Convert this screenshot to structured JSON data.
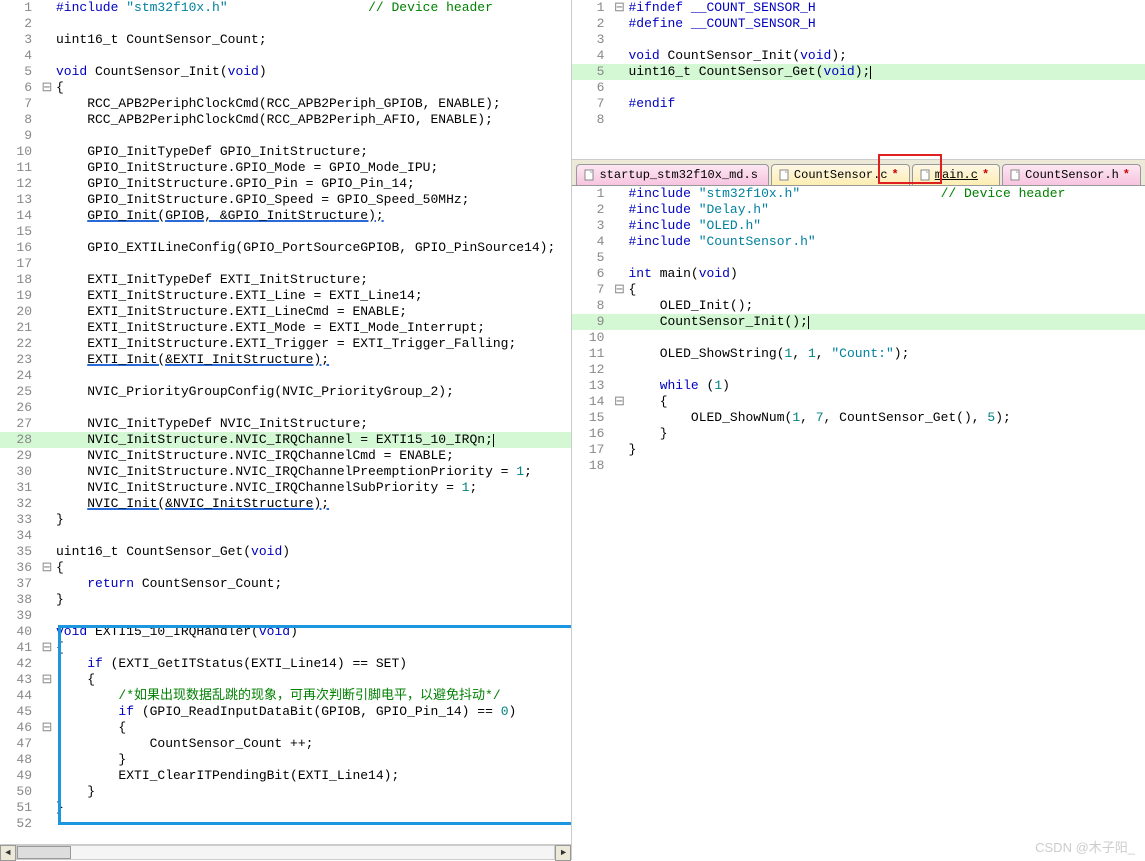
{
  "tabs": {
    "right_bottom": [
      {
        "label": "startup_stm32f10x_md.s",
        "style": "pink",
        "modified": false
      },
      {
        "label": "CountSensor.c",
        "style": "yellow",
        "modified": true,
        "underline": false
      },
      {
        "label": "main.c",
        "style": "yellow",
        "modified": true,
        "underline": true,
        "active_box": true
      },
      {
        "label": "CountSensor.h",
        "style": "pink",
        "modified": true
      }
    ]
  },
  "left_editor": {
    "lines": [
      {
        "n": 1,
        "fold": "",
        "tokens": [
          [
            "#include ",
            "kw"
          ],
          [
            "\"stm32f10x.h\"",
            "str"
          ],
          [
            "                  ",
            ""
          ],
          [
            "// Device header",
            "cmt"
          ]
        ]
      },
      {
        "n": 2,
        "fold": "",
        "tokens": [
          [
            "",
            ""
          ]
        ]
      },
      {
        "n": 3,
        "fold": "",
        "tokens": [
          [
            "uint16_t CountSensor_Count;",
            ""
          ]
        ]
      },
      {
        "n": 4,
        "fold": "",
        "tokens": [
          [
            "",
            ""
          ]
        ]
      },
      {
        "n": 5,
        "fold": "",
        "tokens": [
          [
            "void ",
            "kw"
          ],
          [
            "CountSensor_Init(",
            ""
          ],
          [
            "void",
            "kw"
          ],
          [
            ")",
            ""
          ]
        ]
      },
      {
        "n": 6,
        "fold": "⊟",
        "tokens": [
          [
            "{",
            ""
          ]
        ]
      },
      {
        "n": 7,
        "fold": "",
        "tokens": [
          [
            "    RCC_APB2PeriphClockCmd(RCC_APB2Periph_GPIOB, ENABLE);",
            ""
          ]
        ]
      },
      {
        "n": 8,
        "fold": "",
        "tokens": [
          [
            "    RCC_APB2PeriphClockCmd(RCC_APB2Periph_AFIO, ENABLE);",
            ""
          ]
        ]
      },
      {
        "n": 9,
        "fold": "",
        "tokens": [
          [
            "",
            ""
          ]
        ]
      },
      {
        "n": 10,
        "fold": "",
        "tokens": [
          [
            "    GPIO_InitTypeDef GPIO_InitStructure;",
            ""
          ]
        ]
      },
      {
        "n": 11,
        "fold": "",
        "tokens": [
          [
            "    GPIO_InitStructure.GPIO_Mode = GPIO_Mode_IPU;",
            ""
          ]
        ]
      },
      {
        "n": 12,
        "fold": "",
        "tokens": [
          [
            "    GPIO_InitStructure.GPIO_Pin = GPIO_Pin_14;",
            ""
          ]
        ]
      },
      {
        "n": 13,
        "fold": "",
        "tokens": [
          [
            "    GPIO_InitStructure.GPIO_Speed = GPIO_Speed_50MHz;",
            ""
          ]
        ]
      },
      {
        "n": 14,
        "fold": "",
        "tokens": [
          [
            "    ",
            ""
          ],
          [
            "GPIO_Init(GPIOB, &GPIO_InitStructure);",
            "underline-blue"
          ]
        ]
      },
      {
        "n": 15,
        "fold": "",
        "tokens": [
          [
            "",
            ""
          ]
        ]
      },
      {
        "n": 16,
        "fold": "",
        "tokens": [
          [
            "    GPIO_EXTILineConfig(GPIO_PortSourceGPIOB, GPIO_PinSource14);",
            ""
          ]
        ]
      },
      {
        "n": 17,
        "fold": "",
        "tokens": [
          [
            "",
            ""
          ]
        ]
      },
      {
        "n": 18,
        "fold": "",
        "tokens": [
          [
            "    EXTI_InitTypeDef EXTI_InitStructure;",
            ""
          ]
        ]
      },
      {
        "n": 19,
        "fold": "",
        "tokens": [
          [
            "    EXTI_InitStructure.EXTI_Line = EXTI_Line14;",
            ""
          ]
        ]
      },
      {
        "n": 20,
        "fold": "",
        "tokens": [
          [
            "    EXTI_InitStructure.EXTI_LineCmd = ENABLE;",
            ""
          ]
        ]
      },
      {
        "n": 21,
        "fold": "",
        "tokens": [
          [
            "    EXTI_InitStructure.EXTI_Mode = EXTI_Mode_Interrupt;",
            ""
          ]
        ]
      },
      {
        "n": 22,
        "fold": "",
        "tokens": [
          [
            "    EXTI_InitStructure.EXTI_Trigger = EXTI_Trigger_Falling;",
            ""
          ]
        ]
      },
      {
        "n": 23,
        "fold": "",
        "tokens": [
          [
            "    ",
            ""
          ],
          [
            "EXTI_Init(&EXTI_InitStructure);",
            "underline-blue"
          ]
        ]
      },
      {
        "n": 24,
        "fold": "",
        "tokens": [
          [
            "",
            ""
          ]
        ]
      },
      {
        "n": 25,
        "fold": "",
        "tokens": [
          [
            "    NVIC_PriorityGroupConfig(NVIC_PriorityGroup_2);",
            ""
          ]
        ]
      },
      {
        "n": 26,
        "fold": "",
        "tokens": [
          [
            "",
            ""
          ]
        ]
      },
      {
        "n": 27,
        "fold": "",
        "tokens": [
          [
            "    NVIC_InitTypeDef NVIC_InitStructure;",
            ""
          ]
        ]
      },
      {
        "n": 28,
        "fold": "",
        "hl": true,
        "tokens": [
          [
            "    NVIC_InitStructure.NVIC_IRQChannel = EXTI15_10_IRQn;",
            ""
          ]
        ],
        "cursor": true
      },
      {
        "n": 29,
        "fold": "",
        "tokens": [
          [
            "    NVIC_InitStructure.NVIC_IRQChannelCmd = ENABLE;",
            ""
          ]
        ]
      },
      {
        "n": 30,
        "fold": "",
        "tokens": [
          [
            "    NVIC_InitStructure.NVIC_IRQChannelPreemptionPriority = ",
            ""
          ],
          [
            "1",
            "num-lit"
          ],
          [
            ";",
            ""
          ]
        ]
      },
      {
        "n": 31,
        "fold": "",
        "tokens": [
          [
            "    NVIC_InitStructure.NVIC_IRQChannelSubPriority = ",
            ""
          ],
          [
            "1",
            "num-lit"
          ],
          [
            ";",
            ""
          ]
        ]
      },
      {
        "n": 32,
        "fold": "",
        "tokens": [
          [
            "    ",
            ""
          ],
          [
            "NVIC_Init(&NVIC_InitStructure);",
            "underline-blue"
          ]
        ]
      },
      {
        "n": 33,
        "fold": "",
        "tokens": [
          [
            "}",
            ""
          ]
        ]
      },
      {
        "n": 34,
        "fold": "",
        "tokens": [
          [
            "",
            ""
          ]
        ]
      },
      {
        "n": 35,
        "fold": "",
        "tokens": [
          [
            "uint16_t CountSensor_Get(",
            ""
          ],
          [
            "void",
            "kw"
          ],
          [
            ")",
            ""
          ]
        ]
      },
      {
        "n": 36,
        "fold": "⊟",
        "tokens": [
          [
            "{",
            ""
          ]
        ]
      },
      {
        "n": 37,
        "fold": "",
        "tokens": [
          [
            "    ",
            ""
          ],
          [
            "return ",
            "kw"
          ],
          [
            "CountSensor_Count;",
            ""
          ]
        ]
      },
      {
        "n": 38,
        "fold": "",
        "tokens": [
          [
            "}",
            ""
          ]
        ]
      },
      {
        "n": 39,
        "fold": "",
        "tokens": [
          [
            "",
            ""
          ]
        ]
      },
      {
        "n": 40,
        "fold": "",
        "tokens": [
          [
            "void ",
            "kw"
          ],
          [
            "EXTI15_10_IRQHandler(",
            ""
          ],
          [
            "void",
            "kw"
          ],
          [
            ")",
            ""
          ]
        ]
      },
      {
        "n": 41,
        "fold": "⊟",
        "tokens": [
          [
            "{",
            ""
          ]
        ]
      },
      {
        "n": 42,
        "fold": "",
        "tokens": [
          [
            "    ",
            ""
          ],
          [
            "if ",
            "kw"
          ],
          [
            "(EXTI_GetITStatus(EXTI_Line14) == SET)",
            ""
          ]
        ]
      },
      {
        "n": 43,
        "fold": "⊟",
        "tokens": [
          [
            "    {",
            ""
          ]
        ]
      },
      {
        "n": 44,
        "fold": "",
        "tokens": [
          [
            "        ",
            ""
          ],
          [
            "/*如果出现数据乱跳的现象，可再次判断引脚电平，以避免抖动*/",
            "cmt"
          ]
        ]
      },
      {
        "n": 45,
        "fold": "",
        "tokens": [
          [
            "        ",
            ""
          ],
          [
            "if ",
            "kw"
          ],
          [
            "(GPIO_ReadInputDataBit(GPIOB, GPIO_Pin_14) == ",
            ""
          ],
          [
            "0",
            "num-lit"
          ],
          [
            ")",
            ""
          ]
        ]
      },
      {
        "n": 46,
        "fold": "⊟",
        "tokens": [
          [
            "        {",
            ""
          ]
        ]
      },
      {
        "n": 47,
        "fold": "",
        "tokens": [
          [
            "            CountSensor_Count ++;",
            ""
          ]
        ]
      },
      {
        "n": 48,
        "fold": "",
        "tokens": [
          [
            "        }",
            ""
          ]
        ]
      },
      {
        "n": 49,
        "fold": "",
        "tokens": [
          [
            "        EXTI_ClearITPendingBit(EXTI_Line14);",
            ""
          ]
        ]
      },
      {
        "n": 50,
        "fold": "",
        "tokens": [
          [
            "    }",
            ""
          ]
        ]
      },
      {
        "n": 51,
        "fold": "",
        "tokens": [
          [
            "}",
            ""
          ]
        ]
      },
      {
        "n": 52,
        "fold": "",
        "tokens": [
          [
            "",
            ""
          ]
        ]
      }
    ]
  },
  "right_top_editor": {
    "lines": [
      {
        "n": 1,
        "fold": "⊟",
        "tokens": [
          [
            "#ifndef __COUNT_SENSOR_H",
            "kw"
          ]
        ]
      },
      {
        "n": 2,
        "fold": "",
        "tokens": [
          [
            "#define __COUNT_SENSOR_H",
            "kw"
          ]
        ]
      },
      {
        "n": 3,
        "fold": "",
        "tokens": [
          [
            "",
            ""
          ]
        ]
      },
      {
        "n": 4,
        "fold": "",
        "tokens": [
          [
            "void ",
            "kw"
          ],
          [
            "CountSensor_Init(",
            ""
          ],
          [
            "void",
            "kw"
          ],
          [
            ");",
            ""
          ]
        ]
      },
      {
        "n": 5,
        "fold": "",
        "hl": true,
        "tokens": [
          [
            "uint16_t CountSensor_Get(",
            ""
          ],
          [
            "void",
            "kw"
          ],
          [
            ");",
            ""
          ]
        ],
        "cursor": true
      },
      {
        "n": 6,
        "fold": "",
        "tokens": [
          [
            "",
            ""
          ]
        ]
      },
      {
        "n": 7,
        "fold": "",
        "tokens": [
          [
            "#endif",
            "kw"
          ]
        ]
      },
      {
        "n": 8,
        "fold": "",
        "tokens": [
          [
            "",
            ""
          ]
        ]
      }
    ]
  },
  "right_bottom_editor": {
    "lines": [
      {
        "n": 1,
        "fold": "",
        "tokens": [
          [
            "#include ",
            "kw"
          ],
          [
            "\"stm32f10x.h\"",
            "str"
          ],
          [
            "                  ",
            ""
          ],
          [
            "// Device header",
            "cmt"
          ]
        ]
      },
      {
        "n": 2,
        "fold": "",
        "tokens": [
          [
            "#include ",
            "kw"
          ],
          [
            "\"Delay.h\"",
            "str"
          ]
        ]
      },
      {
        "n": 3,
        "fold": "",
        "tokens": [
          [
            "#include ",
            "kw"
          ],
          [
            "\"OLED.h\"",
            "str"
          ]
        ]
      },
      {
        "n": 4,
        "fold": "",
        "tokens": [
          [
            "#include ",
            "kw"
          ],
          [
            "\"CountSensor.h\"",
            "str"
          ]
        ]
      },
      {
        "n": 5,
        "fold": "",
        "tokens": [
          [
            "",
            ""
          ]
        ]
      },
      {
        "n": 6,
        "fold": "",
        "tokens": [
          [
            "int ",
            "kw"
          ],
          [
            "main(",
            ""
          ],
          [
            "void",
            "kw"
          ],
          [
            ")",
            ""
          ]
        ]
      },
      {
        "n": 7,
        "fold": "⊟",
        "tokens": [
          [
            "{",
            ""
          ]
        ]
      },
      {
        "n": 8,
        "fold": "",
        "tokens": [
          [
            "    OLED_Init();",
            ""
          ]
        ]
      },
      {
        "n": 9,
        "fold": "",
        "hl": true,
        "tokens": [
          [
            "    CountSensor_Init();",
            ""
          ]
        ],
        "cursor": true
      },
      {
        "n": 10,
        "fold": "",
        "tokens": [
          [
            "",
            ""
          ]
        ]
      },
      {
        "n": 11,
        "fold": "",
        "tokens": [
          [
            "    OLED_ShowString(",
            ""
          ],
          [
            "1",
            "num-lit"
          ],
          [
            ", ",
            ""
          ],
          [
            "1",
            "num-lit"
          ],
          [
            ", ",
            ""
          ],
          [
            "\"Count:\"",
            "str"
          ],
          [
            ");",
            ""
          ]
        ]
      },
      {
        "n": 12,
        "fold": "",
        "tokens": [
          [
            "",
            ""
          ]
        ]
      },
      {
        "n": 13,
        "fold": "",
        "tokens": [
          [
            "    ",
            ""
          ],
          [
            "while ",
            "kw"
          ],
          [
            "(",
            ""
          ],
          [
            "1",
            "num-lit"
          ],
          [
            ")",
            ""
          ]
        ]
      },
      {
        "n": 14,
        "fold": "⊟",
        "tokens": [
          [
            "    {",
            ""
          ]
        ]
      },
      {
        "n": 15,
        "fold": "",
        "tokens": [
          [
            "        OLED_ShowNum(",
            ""
          ],
          [
            "1",
            "num-lit"
          ],
          [
            ", ",
            ""
          ],
          [
            "7",
            "num-lit"
          ],
          [
            ", CountSensor_Get(), ",
            ""
          ],
          [
            "5",
            "num-lit"
          ],
          [
            ");",
            ""
          ]
        ]
      },
      {
        "n": 16,
        "fold": "",
        "tokens": [
          [
            "    }",
            ""
          ]
        ]
      },
      {
        "n": 17,
        "fold": "",
        "tokens": [
          [
            "}",
            ""
          ]
        ]
      },
      {
        "n": 18,
        "fold": "",
        "tokens": [
          [
            "",
            ""
          ]
        ]
      }
    ]
  },
  "scrollbar": {
    "thumb_left": "0%",
    "thumb_width": "10%"
  },
  "watermark": "CSDN @木子阳_"
}
